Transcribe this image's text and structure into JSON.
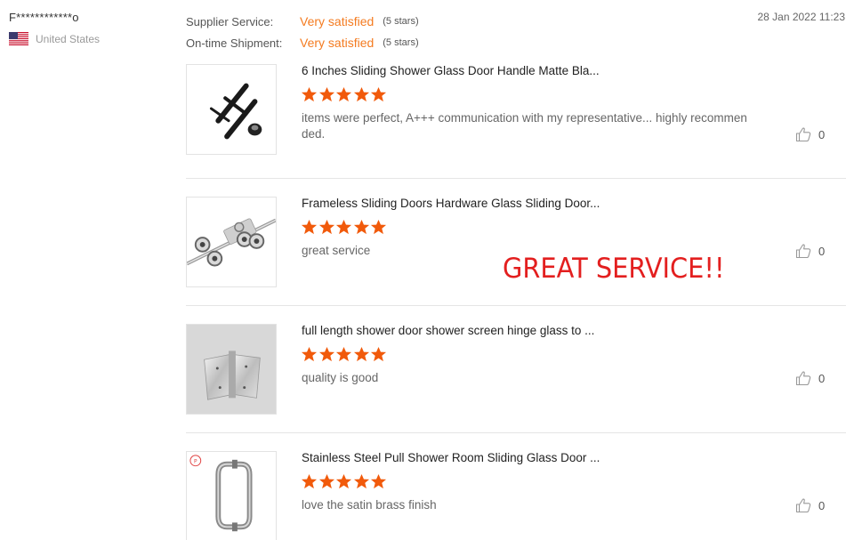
{
  "reviewer": {
    "name": "F************o",
    "country": "United States",
    "country_flag_icon": "us-flag-icon"
  },
  "ratings": [
    {
      "label": "Supplier Service:",
      "value": "Very satisfied",
      "stars": "(5 stars)"
    },
    {
      "label": "On-time Shipment:",
      "value": "Very satisfied",
      "stars": "(5 stars)"
    }
  ],
  "date": "28 Jan 2022 11:23",
  "colors": {
    "accent": "#f47b20",
    "star": "#f15a0b",
    "overlay": "#e31f1f"
  },
  "products": [
    {
      "title": "6 Inches Sliding Shower Glass Door Handle Matte Bla...",
      "rating": 5,
      "comment": "items were perfect, A+++ communication with my representative... highly recommended.",
      "likes": "0",
      "image_icon": "black-door-handle-image"
    },
    {
      "title": "Frameless Sliding Doors Hardware Glass Sliding Door...",
      "rating": 5,
      "comment": "great service",
      "likes": "0",
      "image_icon": "sliding-door-roller-image"
    },
    {
      "title": "full length shower door shower screen hinge glass to ...",
      "rating": 5,
      "comment": "quality is good",
      "likes": "0",
      "image_icon": "glass-hinge-image"
    },
    {
      "title": "Stainless Steel Pull Shower Room Sliding Glass Door ...",
      "rating": 5,
      "comment": "love the satin brass finish",
      "likes": "0",
      "image_icon": "pull-handle-image"
    }
  ],
  "overlay_note": "GREAT SERVICE!!"
}
